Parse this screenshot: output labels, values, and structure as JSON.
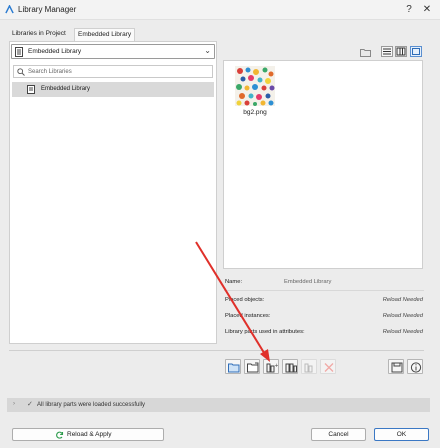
{
  "window": {
    "title": "Library Manager"
  },
  "tabs": [
    {
      "label": "Libraries in Project"
    },
    {
      "label": "Embedded Library"
    }
  ],
  "library_select": {
    "value": "Embedded Library"
  },
  "search": {
    "placeholder": "Search Libraries"
  },
  "library_list": [
    {
      "label": "Embedded Library"
    }
  ],
  "files": [
    {
      "label": "bg2.png"
    }
  ],
  "details": {
    "name_label": "Name:",
    "name_value": "Embedded Library",
    "rows": [
      {
        "label": "Placed objects:",
        "value": "Reload Needed"
      },
      {
        "label": "Placed instances:",
        "value": "Reload Needed"
      },
      {
        "label": "Library parts used in attributes:",
        "value": "Reload Needed"
      }
    ]
  },
  "status": {
    "message": "All library parts were loaded successfully"
  },
  "buttons": {
    "reload_apply": "Reload & Apply",
    "cancel": "Cancel",
    "ok": "OK"
  },
  "colors": {
    "accent": "#3b78c4",
    "annotation_arrow": "#e0302a"
  }
}
